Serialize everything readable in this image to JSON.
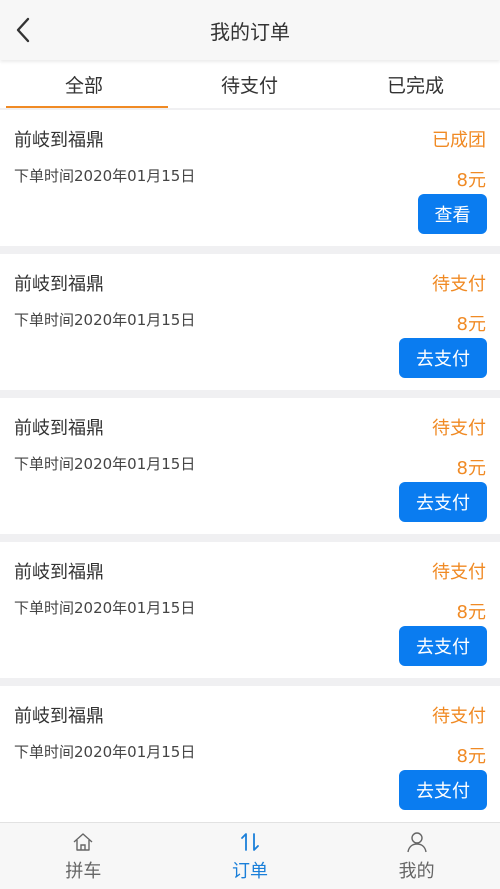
{
  "header": {
    "title": "我的订单"
  },
  "tabs": [
    {
      "label": "全部",
      "active": true
    },
    {
      "label": "待支付",
      "active": false
    },
    {
      "label": "已完成",
      "active": false
    }
  ],
  "orders": [
    {
      "route": "前岐到福鼎",
      "status": "已成团",
      "time": "下单时间2020年01月15日",
      "price": "8元",
      "action": "查看"
    },
    {
      "route": "前岐到福鼎",
      "status": "待支付",
      "time": "下单时间2020年01月15日",
      "price": "8元",
      "action": "去支付"
    },
    {
      "route": "前岐到福鼎",
      "status": "待支付",
      "time": "下单时间2020年01月15日",
      "price": "8元",
      "action": "去支付"
    },
    {
      "route": "前岐到福鼎",
      "status": "待支付",
      "time": "下单时间2020年01月15日",
      "price": "8元",
      "action": "去支付"
    },
    {
      "route": "前岐到福鼎",
      "status": "待支付",
      "time": "下单时间2020年01月15日",
      "price": "8元",
      "action": "去支付"
    }
  ],
  "tabbar": [
    {
      "label": "拼车",
      "icon": "home-icon",
      "active": false
    },
    {
      "label": "订单",
      "icon": "sort-arrows-icon",
      "active": true
    },
    {
      "label": "我的",
      "icon": "user-icon",
      "active": false
    }
  ],
  "colors": {
    "accent": "#f08a24",
    "primary": "#0a7cf0",
    "tab_active": "#1a7fd9"
  }
}
